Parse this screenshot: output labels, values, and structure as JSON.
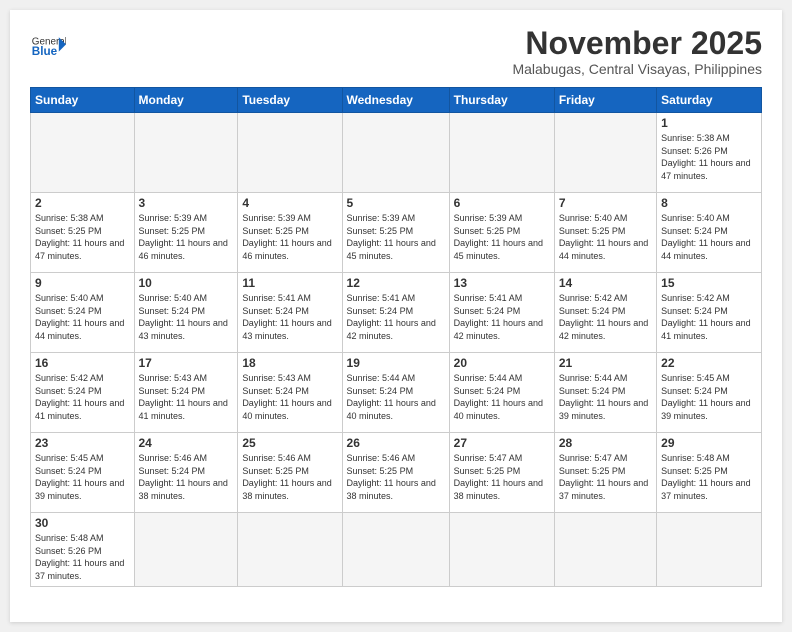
{
  "header": {
    "logo_general": "General",
    "logo_blue": "Blue",
    "month_title": "November 2025",
    "location": "Malabugas, Central Visayas, Philippines"
  },
  "weekdays": [
    "Sunday",
    "Monday",
    "Tuesday",
    "Wednesday",
    "Thursday",
    "Friday",
    "Saturday"
  ],
  "days": {
    "d1": {
      "num": "1",
      "sunrise": "5:38 AM",
      "sunset": "5:26 PM",
      "daylight": "11 hours and 47 minutes."
    },
    "d2": {
      "num": "2",
      "sunrise": "5:38 AM",
      "sunset": "5:25 PM",
      "daylight": "11 hours and 47 minutes."
    },
    "d3": {
      "num": "3",
      "sunrise": "5:39 AM",
      "sunset": "5:25 PM",
      "daylight": "11 hours and 46 minutes."
    },
    "d4": {
      "num": "4",
      "sunrise": "5:39 AM",
      "sunset": "5:25 PM",
      "daylight": "11 hours and 46 minutes."
    },
    "d5": {
      "num": "5",
      "sunrise": "5:39 AM",
      "sunset": "5:25 PM",
      "daylight": "11 hours and 45 minutes."
    },
    "d6": {
      "num": "6",
      "sunrise": "5:39 AM",
      "sunset": "5:25 PM",
      "daylight": "11 hours and 45 minutes."
    },
    "d7": {
      "num": "7",
      "sunrise": "5:40 AM",
      "sunset": "5:25 PM",
      "daylight": "11 hours and 44 minutes."
    },
    "d8": {
      "num": "8",
      "sunrise": "5:40 AM",
      "sunset": "5:24 PM",
      "daylight": "11 hours and 44 minutes."
    },
    "d9": {
      "num": "9",
      "sunrise": "5:40 AM",
      "sunset": "5:24 PM",
      "daylight": "11 hours and 44 minutes."
    },
    "d10": {
      "num": "10",
      "sunrise": "5:40 AM",
      "sunset": "5:24 PM",
      "daylight": "11 hours and 43 minutes."
    },
    "d11": {
      "num": "11",
      "sunrise": "5:41 AM",
      "sunset": "5:24 PM",
      "daylight": "11 hours and 43 minutes."
    },
    "d12": {
      "num": "12",
      "sunrise": "5:41 AM",
      "sunset": "5:24 PM",
      "daylight": "11 hours and 42 minutes."
    },
    "d13": {
      "num": "13",
      "sunrise": "5:41 AM",
      "sunset": "5:24 PM",
      "daylight": "11 hours and 42 minutes."
    },
    "d14": {
      "num": "14",
      "sunrise": "5:42 AM",
      "sunset": "5:24 PM",
      "daylight": "11 hours and 42 minutes."
    },
    "d15": {
      "num": "15",
      "sunrise": "5:42 AM",
      "sunset": "5:24 PM",
      "daylight": "11 hours and 41 minutes."
    },
    "d16": {
      "num": "16",
      "sunrise": "5:42 AM",
      "sunset": "5:24 PM",
      "daylight": "11 hours and 41 minutes."
    },
    "d17": {
      "num": "17",
      "sunrise": "5:43 AM",
      "sunset": "5:24 PM",
      "daylight": "11 hours and 41 minutes."
    },
    "d18": {
      "num": "18",
      "sunrise": "5:43 AM",
      "sunset": "5:24 PM",
      "daylight": "11 hours and 40 minutes."
    },
    "d19": {
      "num": "19",
      "sunrise": "5:44 AM",
      "sunset": "5:24 PM",
      "daylight": "11 hours and 40 minutes."
    },
    "d20": {
      "num": "20",
      "sunrise": "5:44 AM",
      "sunset": "5:24 PM",
      "daylight": "11 hours and 40 minutes."
    },
    "d21": {
      "num": "21",
      "sunrise": "5:44 AM",
      "sunset": "5:24 PM",
      "daylight": "11 hours and 39 minutes."
    },
    "d22": {
      "num": "22",
      "sunrise": "5:45 AM",
      "sunset": "5:24 PM",
      "daylight": "11 hours and 39 minutes."
    },
    "d23": {
      "num": "23",
      "sunrise": "5:45 AM",
      "sunset": "5:24 PM",
      "daylight": "11 hours and 39 minutes."
    },
    "d24": {
      "num": "24",
      "sunrise": "5:46 AM",
      "sunset": "5:24 PM",
      "daylight": "11 hours and 38 minutes."
    },
    "d25": {
      "num": "25",
      "sunrise": "5:46 AM",
      "sunset": "5:25 PM",
      "daylight": "11 hours and 38 minutes."
    },
    "d26": {
      "num": "26",
      "sunrise": "5:46 AM",
      "sunset": "5:25 PM",
      "daylight": "11 hours and 38 minutes."
    },
    "d27": {
      "num": "27",
      "sunrise": "5:47 AM",
      "sunset": "5:25 PM",
      "daylight": "11 hours and 38 minutes."
    },
    "d28": {
      "num": "28",
      "sunrise": "5:47 AM",
      "sunset": "5:25 PM",
      "daylight": "11 hours and 37 minutes."
    },
    "d29": {
      "num": "29",
      "sunrise": "5:48 AM",
      "sunset": "5:25 PM",
      "daylight": "11 hours and 37 minutes."
    },
    "d30": {
      "num": "30",
      "sunrise": "5:48 AM",
      "sunset": "5:26 PM",
      "daylight": "11 hours and 37 minutes."
    }
  },
  "labels": {
    "sunrise_label": "Sunrise:",
    "sunset_label": "Sunset:",
    "daylight_label": "Daylight:"
  }
}
